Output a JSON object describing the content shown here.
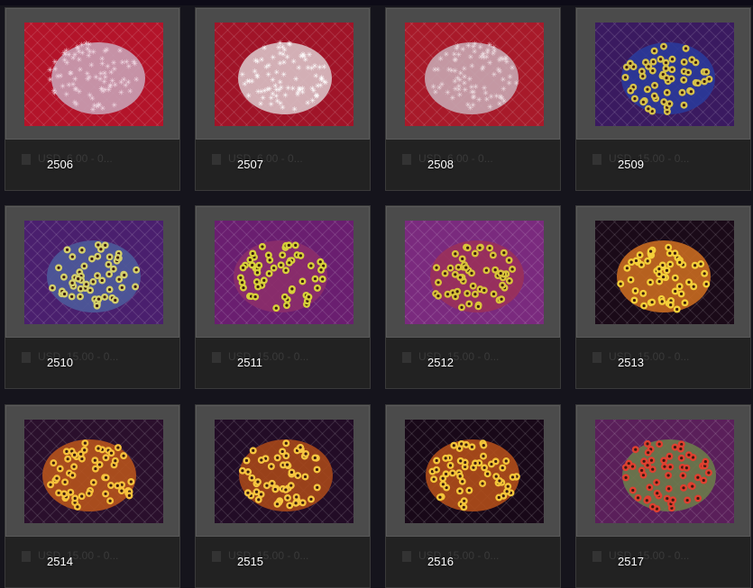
{
  "items": [
    {
      "id": "2506",
      "price": "USD. 6.00 - 0...",
      "bg": "#b3142a",
      "coral": "#c8a0b4",
      "accent": "#f2dce6",
      "kind": "star"
    },
    {
      "id": "2507",
      "price": "USD. 6.00 - 0...",
      "bg": "#a01428",
      "coral": "#d8c0c4",
      "accent": "#ffffff",
      "kind": "star"
    },
    {
      "id": "2508",
      "price": "USD. 6.00 - 0...",
      "bg": "#a81a2a",
      "coral": "#c7a6b0",
      "accent": "#efe0e4",
      "kind": "star"
    },
    {
      "id": "2509",
      "price": "USD. 15.00 - 0...",
      "bg": "#3a1a60",
      "coral": "#2a3a9a",
      "accent": "#d6c24a",
      "kind": "polyp"
    },
    {
      "id": "2510",
      "price": "USD. 15.00 - 0...",
      "bg": "#4a1f6e",
      "coral": "#4d5a9a",
      "accent": "#d4d06a",
      "kind": "polyp"
    },
    {
      "id": "2511",
      "price": "USD. 15.00 - 0...",
      "bg": "#6a1e70",
      "coral": "#8c2d6a",
      "accent": "#d7d13a",
      "kind": "polyp"
    },
    {
      "id": "2512",
      "price": "USD. 15.00 - 0...",
      "bg": "#7a2a7e",
      "coral": "#9a305a",
      "accent": "#d9c43a",
      "kind": "polyp"
    },
    {
      "id": "2513",
      "price": "USD. 15.00 - 0...",
      "bg": "#1a0a18",
      "coral": "#c86a20",
      "accent": "#f4d03a",
      "kind": "polyp"
    },
    {
      "id": "2514",
      "price": "USD. 15.00 - 0...",
      "bg": "#2a0f2c",
      "coral": "#b6531c",
      "accent": "#f6c23c",
      "kind": "polyp"
    },
    {
      "id": "2515",
      "price": "USD. 15.00 - 0...",
      "bg": "#220c26",
      "coral": "#a6471a",
      "accent": "#f6c640",
      "kind": "polyp"
    },
    {
      "id": "2516",
      "price": "USD. 15.00 - 0...",
      "bg": "#180818",
      "coral": "#b04e1a",
      "accent": "#f4c63a",
      "kind": "polyp"
    },
    {
      "id": "2517",
      "price": "USD. 15.00 - 0...",
      "bg": "#5a1f5a",
      "coral": "#6a7a4a",
      "accent": "#e04030",
      "kind": "polyp"
    }
  ]
}
